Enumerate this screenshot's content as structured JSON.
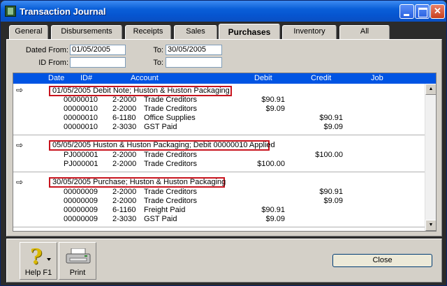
{
  "window": {
    "title": "Transaction Journal"
  },
  "tabs": [
    {
      "label": "General",
      "active": false
    },
    {
      "label": "Disbursements",
      "active": false
    },
    {
      "label": "Receipts",
      "active": false
    },
    {
      "label": "Sales",
      "active": false
    },
    {
      "label": "Purchases",
      "active": true
    },
    {
      "label": "Inventory",
      "active": false
    },
    {
      "label": "All",
      "active": false
    }
  ],
  "filters": {
    "dated_from_label": "Dated From:",
    "dated_from_value": "01/05/2005",
    "to_label": "To:",
    "dated_to_value": "30/05/2005",
    "id_from_label": "ID From:",
    "id_from_value": "",
    "id_to_label": "To:",
    "id_to_value": ""
  },
  "grid": {
    "columns": [
      "Date",
      "ID#",
      "Account",
      "Debit",
      "Credit",
      "Job"
    ],
    "groups": [
      {
        "header": "01/05/2005   Debit Note; Huston & Huston Packaging",
        "rows": [
          {
            "id": "00000010",
            "account": "2-2000",
            "name": "Trade Creditors",
            "debit": "$90.91",
            "credit": ""
          },
          {
            "id": "00000010",
            "account": "2-2000",
            "name": "Trade Creditors",
            "debit": "$9.09",
            "credit": ""
          },
          {
            "id": "00000010",
            "account": "6-1180",
            "name": "Office Supplies",
            "debit": "",
            "credit": "$90.91"
          },
          {
            "id": "00000010",
            "account": "2-3030",
            "name": "GST Paid",
            "debit": "",
            "credit": "$9.09"
          }
        ]
      },
      {
        "header": "05/05/2005   Huston & Huston Packaging;  Debit 00000010 Applied",
        "rows": [
          {
            "id": "PJ000001",
            "account": "2-2000",
            "name": "Trade Creditors",
            "debit": "",
            "credit": "$100.00"
          },
          {
            "id": "PJ000001",
            "account": "2-2000",
            "name": "Trade Creditors",
            "debit": "$100.00",
            "credit": ""
          }
        ]
      },
      {
        "header": "30/05/2005   Purchase; Huston & Huston Packaging",
        "rows": [
          {
            "id": "00000009",
            "account": "2-2000",
            "name": "Trade Creditors",
            "debit": "",
            "credit": "$90.91"
          },
          {
            "id": "00000009",
            "account": "2-2000",
            "name": "Trade Creditors",
            "debit": "",
            "credit": "$9.09"
          },
          {
            "id": "00000009",
            "account": "6-1160",
            "name": "Freight Paid",
            "debit": "$90.91",
            "credit": ""
          },
          {
            "id": "00000009",
            "account": "2-3030",
            "name": "GST Paid",
            "debit": "$9.09",
            "credit": ""
          }
        ]
      }
    ]
  },
  "toolbar": {
    "help_label": "Help F1",
    "print_label": "Print",
    "close_label": "Close"
  },
  "colors": {
    "header_blue": "#0054e3",
    "highlight_red": "#c8141e",
    "face": "#d4d0c8"
  }
}
